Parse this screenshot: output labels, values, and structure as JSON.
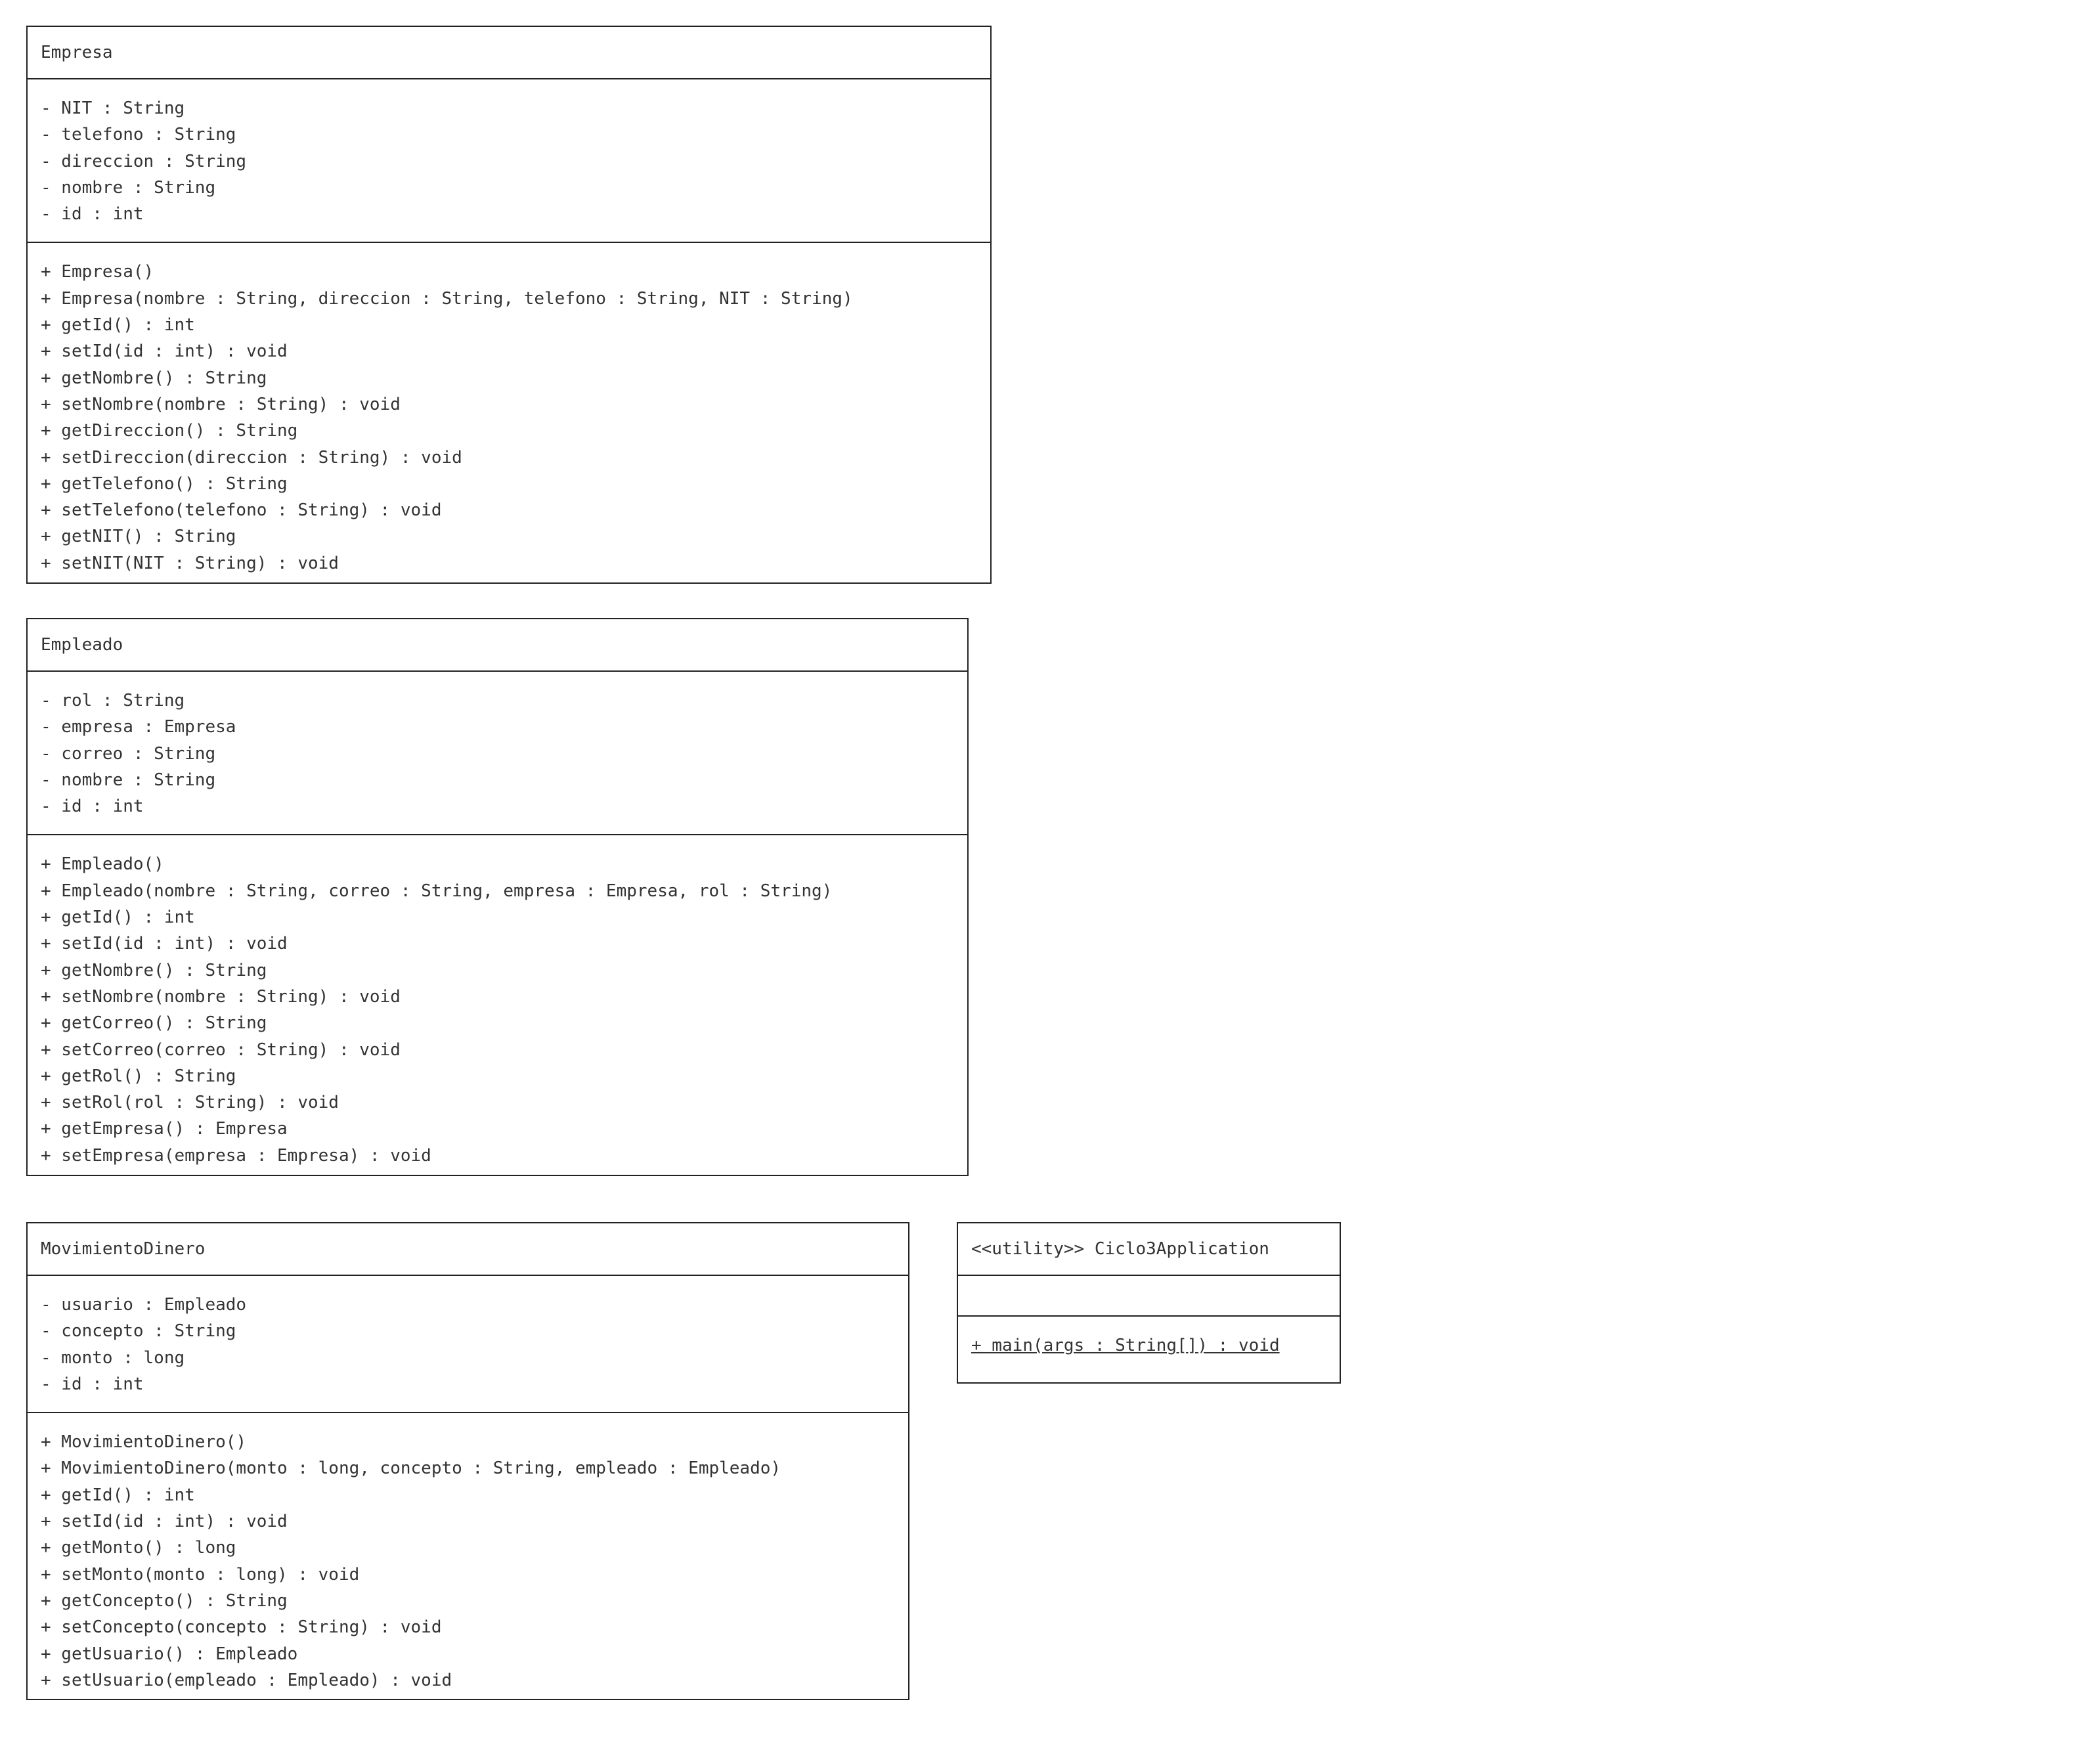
{
  "classes": {
    "empresa": {
      "name": "Empresa",
      "attributes": [
        "- NIT : String",
        "- telefono : String",
        "- direccion : String",
        "- nombre : String",
        "- id : int"
      ],
      "methods": [
        "+ Empresa()",
        "+ Empresa(nombre : String, direccion : String, telefono : String, NIT : String)",
        "+ getId() : int",
        "+ setId(id : int) : void",
        "+ getNombre() : String",
        "+ setNombre(nombre : String) : void",
        "+ getDireccion() : String",
        "+ setDireccion(direccion : String) : void",
        "+ getTelefono() : String",
        "+ setTelefono(telefono : String) : void",
        "+ getNIT() : String",
        "+ setNIT(NIT : String) : void"
      ]
    },
    "empleado": {
      "name": "Empleado",
      "attributes": [
        "- rol : String",
        "- empresa : Empresa",
        "- correo : String",
        "- nombre : String",
        "- id : int"
      ],
      "methods": [
        "+ Empleado()",
        "+ Empleado(nombre : String, correo : String, empresa : Empresa, rol : String)",
        "+ getId() : int",
        "+ setId(id : int) : void",
        "+ getNombre() : String",
        "+ setNombre(nombre : String) : void",
        "+ getCorreo() : String",
        "+ setCorreo(correo : String) : void",
        "+ getRol() : String",
        "+ setRol(rol : String) : void",
        "+ getEmpresa() : Empresa",
        "+ setEmpresa(empresa : Empresa) : void"
      ]
    },
    "movimiento": {
      "name": "MovimientoDinero",
      "attributes": [
        "- usuario : Empleado",
        "- concepto : String",
        "- monto : long",
        "- id : int"
      ],
      "methods": [
        "+ MovimientoDinero()",
        "+ MovimientoDinero(monto : long, concepto : String, empleado : Empleado)",
        "+ getId() : int",
        "+ setId(id : int) : void",
        "+ getMonto() : long",
        "+ setMonto(monto : long) : void",
        "+ getConcepto() : String",
        "+ setConcepto(concepto : String) : void",
        "+ getUsuario() : Empleado",
        "+ setUsuario(empleado : Empleado) : void"
      ]
    },
    "ciclo": {
      "name": "<<utility>> Ciclo3Application",
      "attributes": [],
      "methods": [
        "+ main(args : String[]) : void"
      ]
    }
  }
}
